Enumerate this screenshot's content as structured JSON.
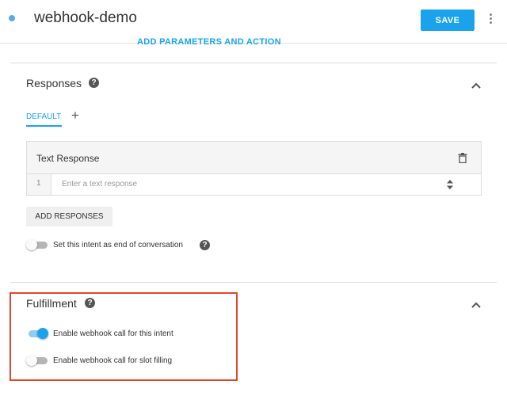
{
  "header": {
    "title": "webhook-demo",
    "save_label": "SAVE",
    "params_link": "ADD PARAMETERS AND ACTION"
  },
  "responses": {
    "title": "Responses",
    "help_symbol": "?",
    "tabs": [
      {
        "label": "DEFAULT",
        "active": true
      }
    ],
    "add_tab_symbol": "+",
    "card": {
      "title": "Text Response",
      "rows": [
        {
          "number": "1",
          "placeholder": "Enter a text response",
          "value": ""
        }
      ]
    },
    "add_responses_label": "ADD RESPONSES",
    "end_conversation": {
      "label": "Set this intent as end of conversation",
      "enabled": false
    }
  },
  "fulfillment": {
    "title": "Fulfillment",
    "help_symbol": "?",
    "webhook_intent": {
      "label": "Enable webhook call for this intent",
      "enabled": true
    },
    "webhook_slot": {
      "label": "Enable webhook call for slot filling",
      "enabled": false
    }
  },
  "colors": {
    "accent": "#1aa3ec",
    "highlight": "#e0472a",
    "status_dot": "#5aa9e6"
  },
  "icons": [
    "status-dot",
    "kebab-menu-icon",
    "help-icon",
    "chevron-up-icon",
    "plus-icon",
    "trash-icon",
    "stepper-icon"
  ]
}
